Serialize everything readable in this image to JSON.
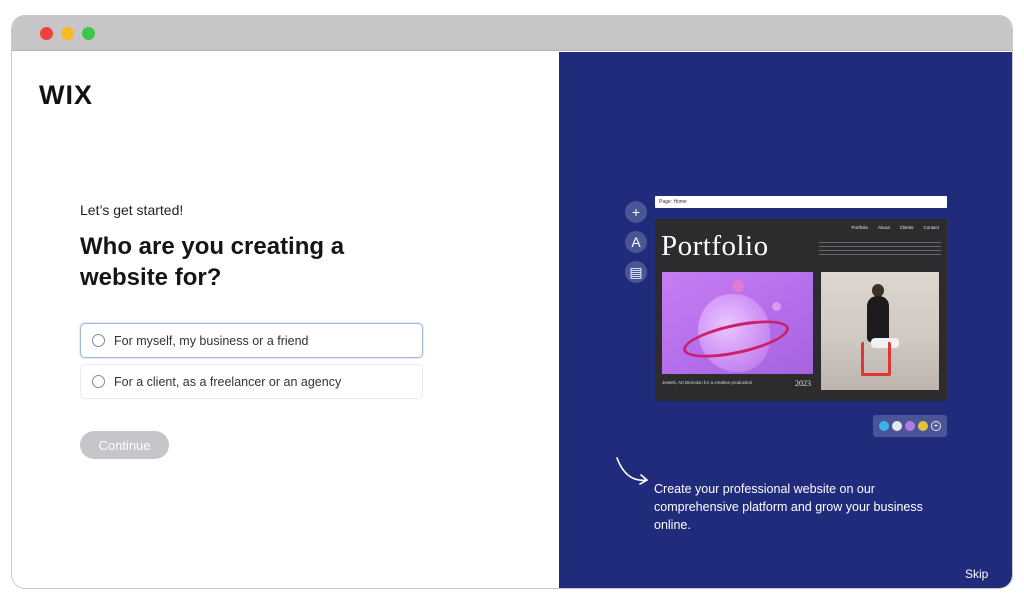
{
  "window": {
    "controls": [
      "close",
      "minimize",
      "maximize"
    ]
  },
  "brand": {
    "logo": "WIX"
  },
  "onboarding": {
    "eyebrow": "Let’s get started!",
    "heading": "Who are you creating a website for?",
    "options": [
      {
        "label": "For myself, my business or a friend",
        "selected": false
      },
      {
        "label": "For a client, as a freelancer or an agency",
        "selected": false
      }
    ],
    "continue_label": "Continue"
  },
  "preview": {
    "tools": [
      {
        "icon": "plus-icon",
        "glyph": "+"
      },
      {
        "icon": "design-icon",
        "glyph": "A"
      },
      {
        "icon": "page-icon",
        "glyph": "▤"
      }
    ],
    "address_label": "Page: Home",
    "site": {
      "title": "Portfolio",
      "nav": [
        "Portfolio",
        "About",
        "Clients",
        "Contact"
      ],
      "caption": "Jewels, Art Direction for a creative production",
      "year": "2023"
    },
    "palette": [
      "#3fb2ea",
      "#e6e6f0",
      "#b07be8",
      "#e2c240"
    ]
  },
  "promo": {
    "text": "Create your professional website on our comprehensive platform and grow your business online."
  },
  "skip_label": "Skip",
  "colors": {
    "right_panel": "#202b7b",
    "continue_button": "#c6c6ca",
    "selected_border": "#9fb9d6"
  }
}
